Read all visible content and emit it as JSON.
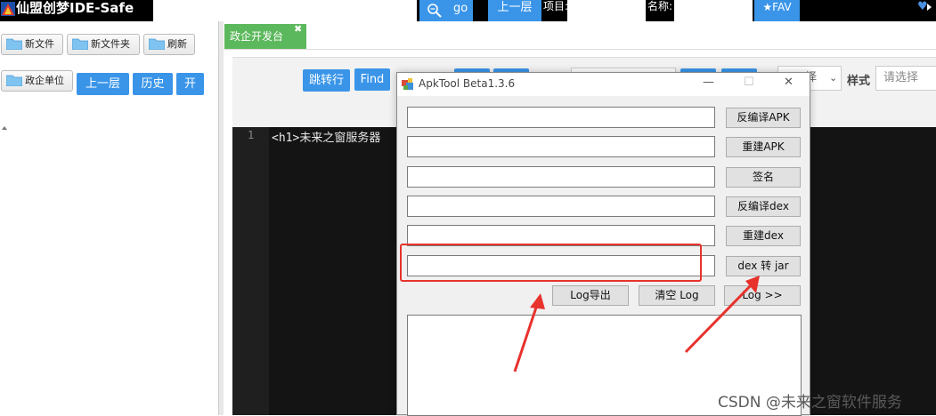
{
  "top_bar": {
    "app_title": "仙盟创梦IDE-Safe",
    "go_label": "go",
    "up_label": "上一层",
    "project_label": "项目:",
    "name_label": "名称:",
    "fav_label": "★FAV",
    "icons": [
      "app-logo-icon",
      "search-zoom-icon",
      "heart-icon"
    ]
  },
  "left_panel": {
    "buttons": [
      "新文件",
      "新文件夹",
      "刷新",
      "政企单位"
    ],
    "blue_buttons": [
      "上一层",
      "历史",
      "开"
    ]
  },
  "tabs": [
    {
      "label": "政企开发台",
      "active": true
    }
  ],
  "editor_toolbar": {
    "jump_label": "跳转行",
    "find_label": "Find",
    "select_text": "择",
    "style_label": "样式",
    "style_placeholder": "请选择"
  },
  "editor": {
    "line_number": "1",
    "code_tag": "<h1>",
    "code_text": "未来之窗服务器"
  },
  "dialog": {
    "title": "ApkTool Beta1.3.6",
    "minimize": "—",
    "maximize": "☐",
    "close": "✕",
    "action_buttons": [
      "反编译APK",
      "重建APK",
      "签名",
      "反编译dex",
      "重建dex",
      "dex 转 jar"
    ],
    "log_buttons": [
      "Log导出",
      "清空 Log",
      "Log >>"
    ]
  },
  "watermark": "CSDN @未来之窗软件服务",
  "colors": {
    "accent_blue": "#3a95e9",
    "tab_green": "#5cb85c",
    "annotation_red": "#e8322c"
  }
}
